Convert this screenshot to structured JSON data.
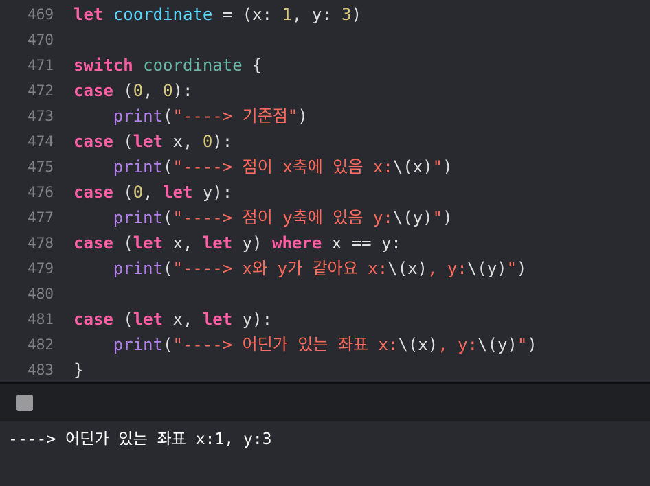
{
  "editor": {
    "lines": [
      {
        "num": "469",
        "tokens": [
          {
            "t": "let",
            "c": "kw"
          },
          {
            "t": " ",
            "c": "plain"
          },
          {
            "t": "coordinate",
            "c": "ident"
          },
          {
            "t": " = (x: ",
            "c": "plain"
          },
          {
            "t": "1",
            "c": "num"
          },
          {
            "t": ", y: ",
            "c": "plain"
          },
          {
            "t": "3",
            "c": "num"
          },
          {
            "t": ")",
            "c": "plain"
          }
        ]
      },
      {
        "num": "470",
        "tokens": []
      },
      {
        "num": "471",
        "tokens": [
          {
            "t": "switch",
            "c": "kw"
          },
          {
            "t": " ",
            "c": "plain"
          },
          {
            "t": "coordinate",
            "c": "type"
          },
          {
            "t": " {",
            "c": "plain"
          }
        ]
      },
      {
        "num": "472",
        "tokens": [
          {
            "t": "case",
            "c": "kw"
          },
          {
            "t": " (",
            "c": "plain"
          },
          {
            "t": "0",
            "c": "num"
          },
          {
            "t": ", ",
            "c": "plain"
          },
          {
            "t": "0",
            "c": "num"
          },
          {
            "t": "):",
            "c": "plain"
          }
        ]
      },
      {
        "num": "473",
        "tokens": [
          {
            "t": "    ",
            "c": "plain"
          },
          {
            "t": "print",
            "c": "fn"
          },
          {
            "t": "(",
            "c": "plain"
          },
          {
            "t": "\"----> 기준점\"",
            "c": "str"
          },
          {
            "t": ")",
            "c": "plain"
          }
        ]
      },
      {
        "num": "474",
        "tokens": [
          {
            "t": "case",
            "c": "kw"
          },
          {
            "t": " (",
            "c": "plain"
          },
          {
            "t": "let",
            "c": "kw"
          },
          {
            "t": " x, ",
            "c": "plain"
          },
          {
            "t": "0",
            "c": "num"
          },
          {
            "t": "):",
            "c": "plain"
          }
        ]
      },
      {
        "num": "475",
        "tokens": [
          {
            "t": "    ",
            "c": "plain"
          },
          {
            "t": "print",
            "c": "fn"
          },
          {
            "t": "(",
            "c": "plain"
          },
          {
            "t": "\"----> 점이 x축에 있음 x:",
            "c": "str"
          },
          {
            "t": "\\(x)",
            "c": "plain"
          },
          {
            "t": "\"",
            "c": "str"
          },
          {
            "t": ")",
            "c": "plain"
          }
        ]
      },
      {
        "num": "476",
        "tokens": [
          {
            "t": "case",
            "c": "kw"
          },
          {
            "t": " (",
            "c": "plain"
          },
          {
            "t": "0",
            "c": "num"
          },
          {
            "t": ", ",
            "c": "plain"
          },
          {
            "t": "let",
            "c": "kw"
          },
          {
            "t": " y):",
            "c": "plain"
          }
        ]
      },
      {
        "num": "477",
        "tokens": [
          {
            "t": "    ",
            "c": "plain"
          },
          {
            "t": "print",
            "c": "fn"
          },
          {
            "t": "(",
            "c": "plain"
          },
          {
            "t": "\"----> 점이 y축에 있음 y:",
            "c": "str"
          },
          {
            "t": "\\(y)",
            "c": "plain"
          },
          {
            "t": "\"",
            "c": "str"
          },
          {
            "t": ")",
            "c": "plain"
          }
        ]
      },
      {
        "num": "478",
        "tokens": [
          {
            "t": "case",
            "c": "kw"
          },
          {
            "t": " (",
            "c": "plain"
          },
          {
            "t": "let",
            "c": "kw"
          },
          {
            "t": " x, ",
            "c": "plain"
          },
          {
            "t": "let",
            "c": "kw"
          },
          {
            "t": " y) ",
            "c": "plain"
          },
          {
            "t": "where",
            "c": "kw"
          },
          {
            "t": " x == y:",
            "c": "plain"
          }
        ]
      },
      {
        "num": "479",
        "tokens": [
          {
            "t": "    ",
            "c": "plain"
          },
          {
            "t": "print",
            "c": "fn"
          },
          {
            "t": "(",
            "c": "plain"
          },
          {
            "t": "\"----> x와 y가 같아요 x:",
            "c": "str"
          },
          {
            "t": "\\(x)",
            "c": "plain"
          },
          {
            "t": ", y:",
            "c": "str"
          },
          {
            "t": "\\(y)",
            "c": "plain"
          },
          {
            "t": "\"",
            "c": "str"
          },
          {
            "t": ")",
            "c": "plain"
          }
        ]
      },
      {
        "num": "480",
        "tokens": []
      },
      {
        "num": "481",
        "tokens": [
          {
            "t": "case",
            "c": "kw"
          },
          {
            "t": " (",
            "c": "plain"
          },
          {
            "t": "let",
            "c": "kw"
          },
          {
            "t": " x, ",
            "c": "plain"
          },
          {
            "t": "let",
            "c": "kw"
          },
          {
            "t": " y):",
            "c": "plain"
          }
        ]
      },
      {
        "num": "482",
        "tokens": [
          {
            "t": "    ",
            "c": "plain"
          },
          {
            "t": "print",
            "c": "fn"
          },
          {
            "t": "(",
            "c": "plain"
          },
          {
            "t": "\"----> 어딘가 있는 좌표 x:",
            "c": "str"
          },
          {
            "t": "\\(x)",
            "c": "plain"
          },
          {
            "t": ", y:",
            "c": "str"
          },
          {
            "t": "\\(y)",
            "c": "plain"
          },
          {
            "t": "\"",
            "c": "str"
          },
          {
            "t": ")",
            "c": "plain"
          }
        ]
      },
      {
        "num": "483",
        "tokens": [
          {
            "t": "}",
            "c": "plain"
          }
        ]
      }
    ]
  },
  "debug": {
    "stop_icon": "stop-square-icon"
  },
  "console": {
    "output": "----> 어딘가 있는 좌표 x:1, y:3"
  },
  "colors": {
    "keyword": "#fc5fa3",
    "identifier": "#5dd8ff",
    "type": "#67b7a4",
    "plain": "#dfdfe0",
    "number": "#d9c97c",
    "string": "#fc6a5d",
    "function": "#b281eb",
    "background": "#292a30"
  }
}
